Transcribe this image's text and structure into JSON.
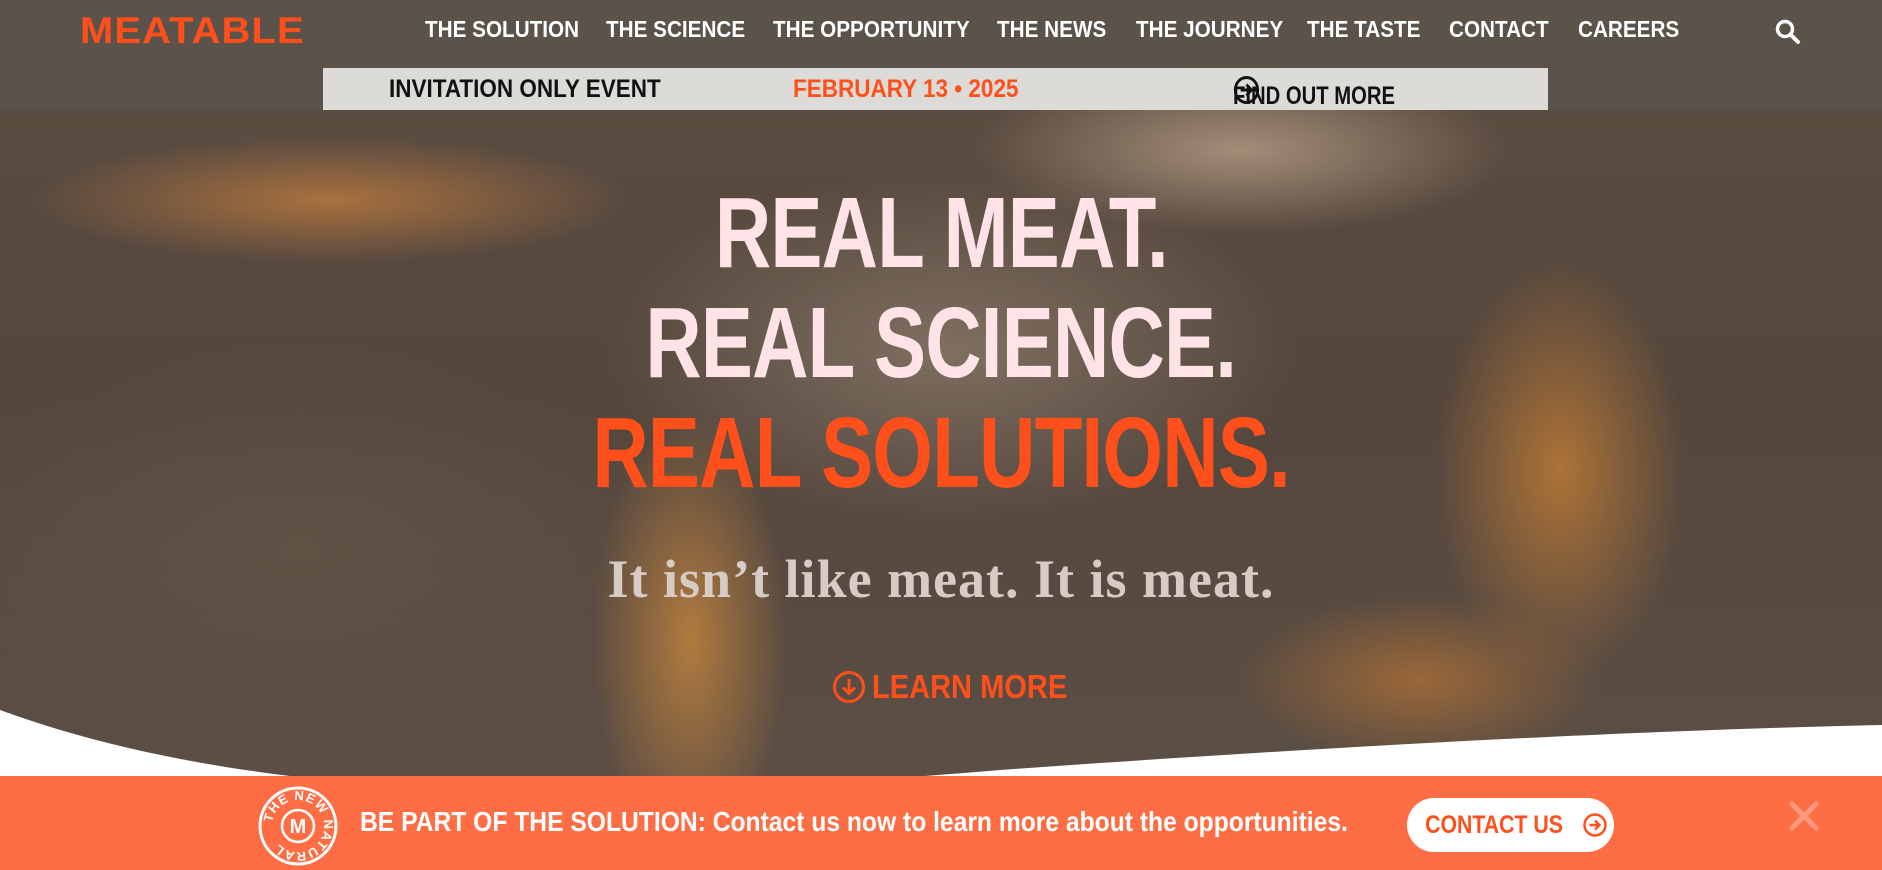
{
  "brand": {
    "logo_text": "MEATABLE",
    "accent_color": "#ff4f1a"
  },
  "nav": {
    "items": [
      {
        "label": "THE SOLUTION"
      },
      {
        "label": "THE SCIENCE"
      },
      {
        "label": "THE OPPORTUNITY"
      },
      {
        "label": "THE NEWS"
      },
      {
        "label": "THE JOURNEY"
      },
      {
        "label": "THE TASTE"
      },
      {
        "label": "CONTACT"
      },
      {
        "label": "CAREERS"
      }
    ],
    "search_icon": "search-icon"
  },
  "event_banner": {
    "title": "INVITATION ONLY EVENT",
    "date": "FEBRUARY 13 • 2025",
    "link_label": "FIND OUT MORE",
    "link_icon": "arrow-right-circle-icon"
  },
  "hero": {
    "line1": "REAL MEAT.",
    "line2": "REAL SCIENCE.",
    "line3": "REAL SOLUTIONS.",
    "tagline": "It isn’t like meat. It is meat.",
    "learn_more_label": "LEARN MORE",
    "learn_more_icon": "arrow-down-circle-icon"
  },
  "cta_bar": {
    "badge_text": "THE NEW NATURAL",
    "badge_letter": "M",
    "message": "BE PART OF THE SOLUTION: Contact us now to learn more about the opportunities.",
    "button_label": "CONTACT US",
    "button_icon": "arrow-right-circle-icon",
    "close_icon": "close-icon",
    "background_color": "#ff6d45"
  }
}
